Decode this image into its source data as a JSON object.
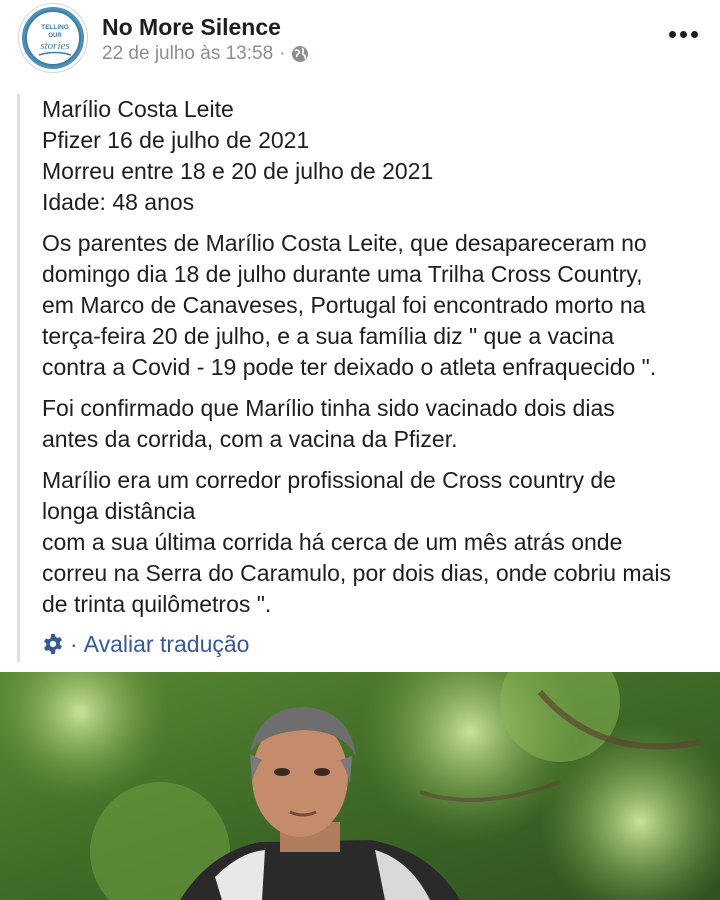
{
  "post": {
    "page_name": "No More Silence",
    "timestamp": "22 de julho às 13:58",
    "separator": "·",
    "privacy_icon": "globe-icon",
    "more_icon": "more-options-icon",
    "avatar": {
      "logo_text_top": "TELLING",
      "logo_text_mid": "OUR",
      "logo_text_bottom": "stories",
      "ring_color": "#4f8fb8"
    }
  },
  "content": {
    "intro": [
      "Marílio Costa Leite",
      "Pfizer 16 de julho de 2021",
      "Morreu entre 18 e 20 de julho de 2021",
      "Idade: 48 anos"
    ],
    "paragraph1": [
      "Os parentes de Marílio Costa Leite, que desapareceram no",
      "domingo dia 18 de julho durante uma Trilha Cross Country,",
      "em Marco de Canaveses, Portugal foi encontrado morto na",
      "terça-feira 20 de julho, e a sua família diz \" que a vacina",
      "contra a Covid - 19 pode ter deixado o atleta enfraquecido \"."
    ],
    "paragraph2": [
      "Foi confirmado que Marílio tinha sido vacinado dois dias",
      "antes da corrida, com a vacina da Pfizer."
    ],
    "paragraph3": [
      "Marílio era um corredor profissional de Cross country de",
      "longa distância",
      "com a sua última corrida há cerca de um mês atrás onde",
      "correu na Serra do Caramulo, por dois dias, onde cobriu mais",
      "de trinta quilômetros \"."
    ]
  },
  "translation": {
    "icon": "gear-icon",
    "separator": "·",
    "label": "Avaliar tradução",
    "link_color": "#385898"
  },
  "colors": {
    "text": "#1c1e21",
    "meta": "#8a8d91",
    "quote_bar": "#dcdfe3"
  }
}
